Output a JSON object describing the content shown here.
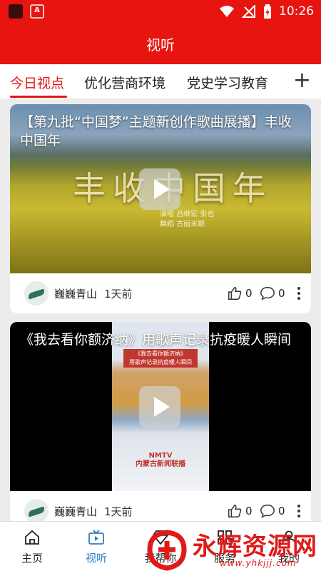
{
  "status_bar": {
    "time": "10:26",
    "badge": "A"
  },
  "app_bar": {
    "title": "视听"
  },
  "tabs": {
    "items": [
      {
        "label": "今日视点",
        "active": true
      },
      {
        "label": "优化营商环境",
        "active": false
      },
      {
        "label": "党史学习教育",
        "active": false
      }
    ],
    "add_label": "+"
  },
  "cards": [
    {
      "title": "【第九批“中国梦”主题新创作歌曲展播】丰收中国年",
      "thumb_calligraphy": "丰收中国年",
      "thumb_credits": [
        "演唱 吕继宏 张也",
        "舞蹈 古丽米娜"
      ],
      "author": "巍巍青山",
      "time_ago": "1天前",
      "likes": "0",
      "comments": "0"
    },
    {
      "title": "《我去看你额济纳》用歌声记录抗疫暖人瞬间",
      "thumb_caption_line1": "《我去看你额济纳》",
      "thumb_caption_line2": "用歌声记录抗疫暖人瞬间",
      "thumb_logo_line1": "NMTV",
      "thumb_logo_line2": "内蒙古新闻联播",
      "author": "巍巍青山",
      "time_ago": "1天前",
      "likes": "0",
      "comments": "0"
    }
  ],
  "bottom_nav": [
    {
      "label": "主页",
      "icon": "home-icon",
      "active": false
    },
    {
      "label": "视听",
      "icon": "tv-icon",
      "active": true
    },
    {
      "label": "我帮你",
      "icon": "gem-icon",
      "active": false
    },
    {
      "label": "服务",
      "icon": "grid-icon",
      "active": false
    },
    {
      "label": "我的",
      "icon": "person-icon",
      "active": false
    }
  ],
  "watermark": {
    "text": "永辉资源网",
    "url": "www.yhkjjj.com"
  },
  "colors": {
    "brand_red": "#e8140f",
    "active_blue": "#2f7fc1"
  }
}
